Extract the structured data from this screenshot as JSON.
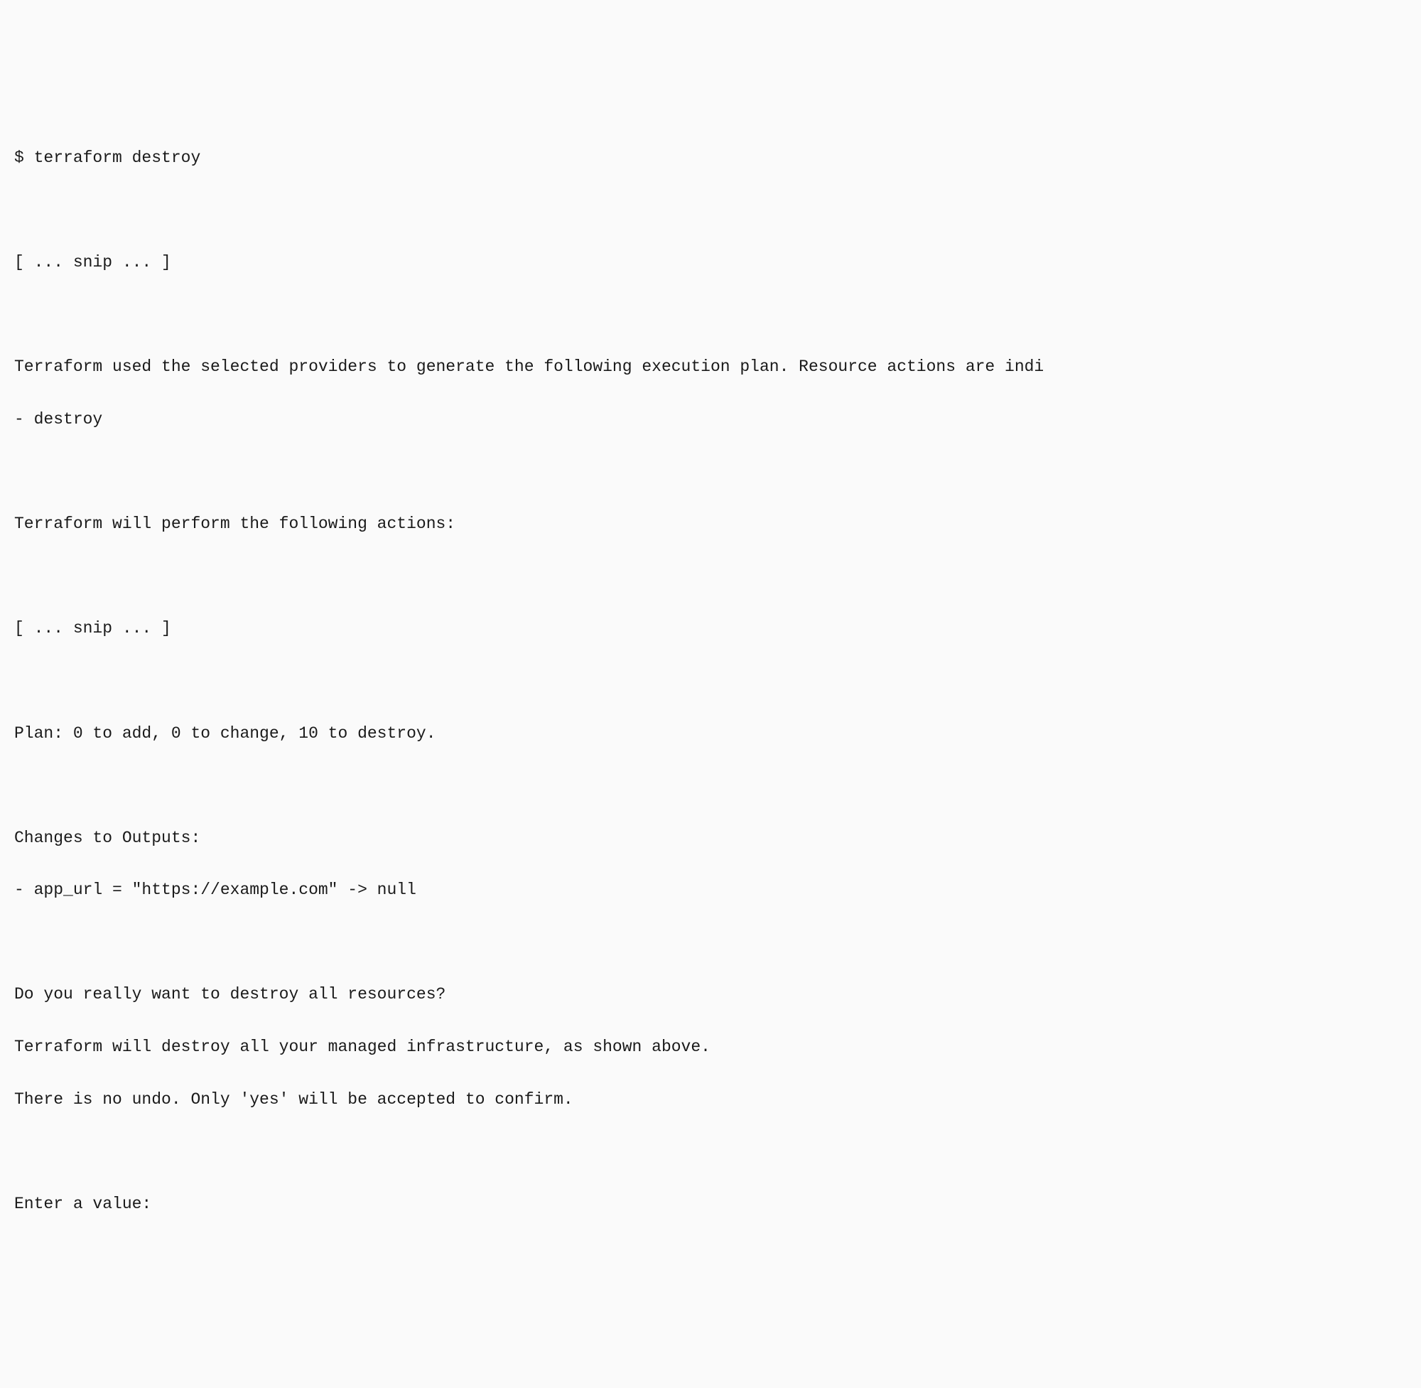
{
  "terminal": {
    "lines": [
      "$ terraform destroy",
      "",
      "[ ... snip ... ]",
      "",
      "Terraform used the selected providers to generate the following execution plan. Resource actions are indi",
      "- destroy",
      "",
      "Terraform will perform the following actions:",
      "",
      "[ ... snip ... ]",
      "",
      "Plan: 0 to add, 0 to change, 10 to destroy.",
      "",
      "Changes to Outputs:",
      "- app_url = \"https://example.com\" -> null",
      "",
      "Do you really want to destroy all resources?",
      "Terraform will destroy all your managed infrastructure, as shown above.",
      "There is no undo. Only 'yes' will be accepted to confirm.",
      "",
      "Enter a value:"
    ]
  }
}
